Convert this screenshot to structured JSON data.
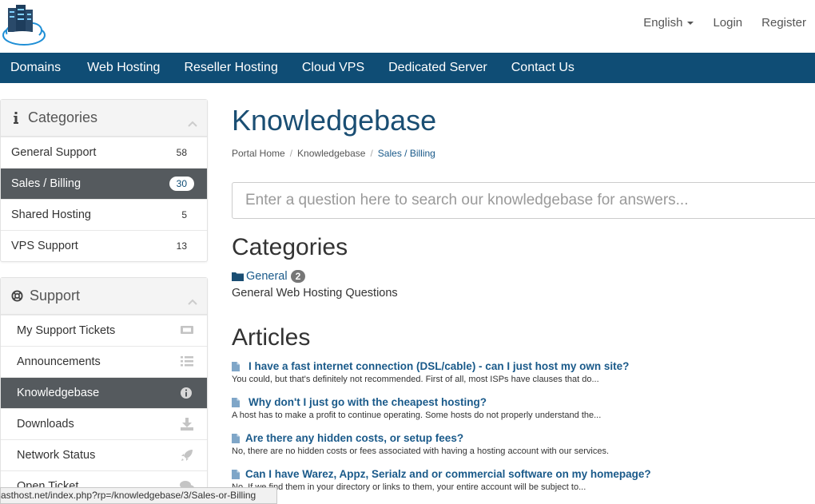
{
  "header": {
    "language": "English",
    "login": "Login",
    "register": "Register"
  },
  "nav": [
    "Domains",
    "Web Hosting",
    "Reseller Hosting",
    "Cloud VPS",
    "Dedicated Server",
    "Contact Us"
  ],
  "sidebar": {
    "categories": {
      "title": "Categories",
      "items": [
        {
          "label": "General Support",
          "count": "58"
        },
        {
          "label": "Sales / Billing",
          "count": "30",
          "active": true
        },
        {
          "label": "Shared Hosting",
          "count": "5"
        },
        {
          "label": "VPS Support",
          "count": "13"
        }
      ]
    },
    "support": {
      "title": "Support",
      "items": [
        {
          "label": "My Support Tickets",
          "icon": "ticket-icon"
        },
        {
          "label": "Announcements",
          "icon": "list-icon"
        },
        {
          "label": "Knowledgebase",
          "icon": "info-circle-icon",
          "active": true
        },
        {
          "label": "Downloads",
          "icon": "download-icon"
        },
        {
          "label": "Network Status",
          "icon": "rocket-icon"
        },
        {
          "label": "Open Ticket",
          "icon": "comments-icon"
        }
      ]
    }
  },
  "main": {
    "title": "Knowledgebase",
    "breadcrumb": [
      "Portal Home",
      "Knowledgebase",
      "Sales / Billing"
    ],
    "search_placeholder": "Enter a question here to search our knowledgebase for answers...",
    "categories_heading": "Categories",
    "category": {
      "name": "General",
      "count": "2",
      "description": "General Web Hosting Questions"
    },
    "articles_heading": "Articles",
    "articles": [
      {
        "title": "I have a fast internet connection (DSL/cable) - can I just host my own site?",
        "summary": "You could, but that's definitely not recommended. First of all, most ISPs have clauses that do..."
      },
      {
        "title": "Why don't I just go with the cheapest hosting?",
        "summary": "A host has to make a profit to continue operating. Some hosts do not properly understand the..."
      },
      {
        "title": "Are there any hidden costs, or setup fees?",
        "summary": "No, there are no hidden costs or fees associated with having a hosting account with our services."
      },
      {
        "title": "Can I have Warez, Appz, Serialz and or commercial software on my homepage?",
        "summary": "No. If we find them in your directory or links to them, your entire account will be subject to..."
      }
    ]
  },
  "statusbar": "asthost.net/index.php?rp=/knowledgebase/3/Sales-or-Billing",
  "colors": {
    "nav": "#0f4d75",
    "title": "#1a4e73",
    "link": "#1a5a8a",
    "active_row": "#555a5e"
  }
}
